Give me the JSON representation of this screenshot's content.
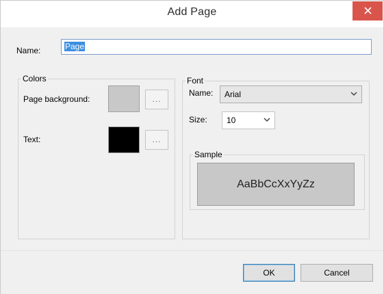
{
  "window": {
    "title": "Add Page"
  },
  "name_field": {
    "label": "Name:",
    "value": "Page"
  },
  "colors": {
    "legend": "Colors",
    "page_background": {
      "label": "Page background:",
      "swatch": "#c8c8c8",
      "button": "..."
    },
    "text": {
      "label": "Text:",
      "swatch": "#000000",
      "button": "..."
    }
  },
  "font": {
    "legend": "Font",
    "name_label": "Name:",
    "name_value": "Arial",
    "size_label": "Size:",
    "size_value": "10",
    "sample_legend": "Sample",
    "sample_text": "AaBbCcXxYyZz"
  },
  "buttons": {
    "ok": "OK",
    "cancel": "Cancel"
  },
  "colors_theme": {
    "close_bg": "#d9554c",
    "selection": "#3b8ee0"
  }
}
